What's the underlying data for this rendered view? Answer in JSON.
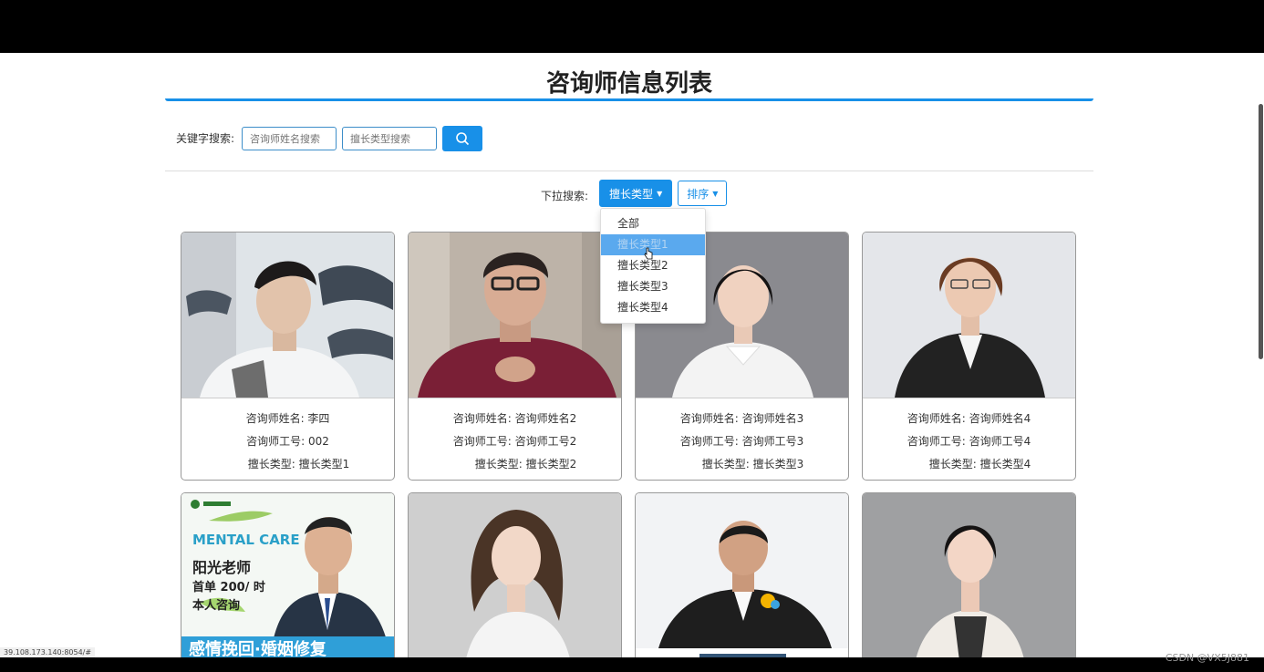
{
  "page": {
    "title": "咨询师信息列表"
  },
  "search": {
    "label": "关键字搜索:",
    "name_placeholder": "咨询师姓名搜索",
    "type_placeholder": "擅长类型搜索"
  },
  "filter": {
    "label": "下拉搜索:",
    "type_button": "擅长类型",
    "sort_button": "排序",
    "menu_items": [
      "全部",
      "擅长类型1",
      "擅长类型2",
      "擅长类型3",
      "擅长类型4"
    ],
    "hovered_index": 1
  },
  "cards_row1": [
    {
      "name": "咨询师姓名: 李四",
      "id": "咨询师工号: 002",
      "type": "擅长类型: 擅长类型1"
    },
    {
      "name": "咨询师姓名: 咨询师姓名2",
      "id": "咨询师工号: 咨询师工号2",
      "type": "擅长类型: 擅长类型2"
    },
    {
      "name": "咨询师姓名: 咨询师姓名3",
      "id": "咨询师工号: 咨询师工号3",
      "type": "擅长类型: 擅长类型3"
    },
    {
      "name": "咨询师姓名: 咨询师姓名4",
      "id": "咨询师工号: 咨询师工号4",
      "type": "擅长类型: 擅长类型4"
    }
  ],
  "poster": {
    "brand": "MENTAL CARE",
    "teacher": "阳光老师",
    "price": "首单 200/ 时",
    "self": "本人咨询",
    "banner": "感情挽回·婚姻修复"
  },
  "status_url": "39.108.173.140:8054/#",
  "watermark": "CSDN @VX5J881",
  "colors": {
    "primary": "#1890e8",
    "hover": "#5aa9ee"
  }
}
